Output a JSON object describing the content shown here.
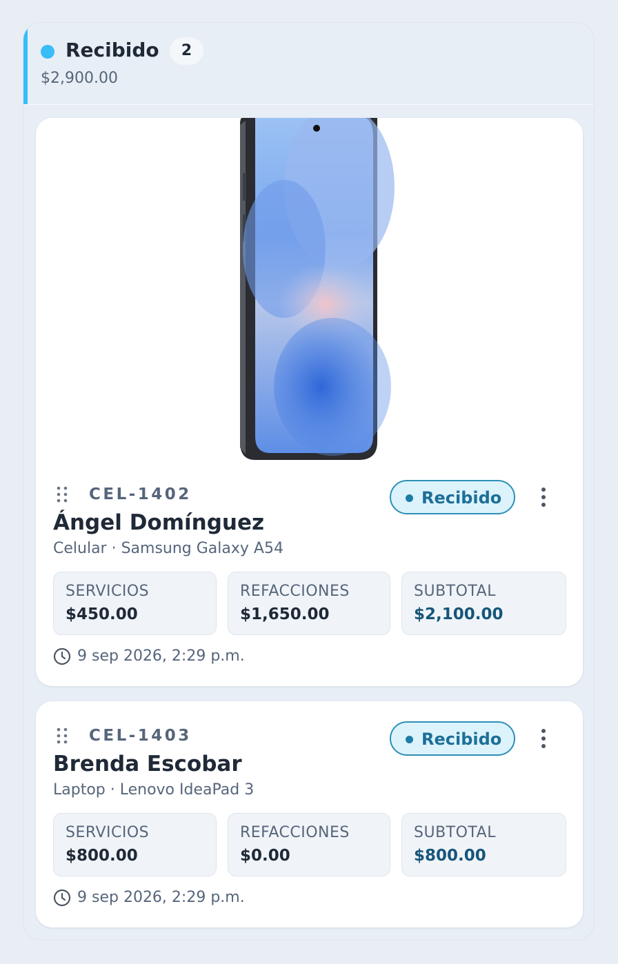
{
  "column": {
    "title": "Recibido",
    "count": "2",
    "total": "$2,900.00",
    "accent_color": "#38bdf8"
  },
  "icons": {
    "drag": "drag-handle-icon",
    "more": "more-vertical-icon",
    "clock": "clock-icon",
    "status": "status-dot-icon"
  },
  "cards": [
    {
      "code": "CEL-1402",
      "status": "Recibido",
      "customer": "Ángel Domínguez",
      "device": "Celular · Samsung Galaxy A54",
      "has_image": true,
      "stats": [
        {
          "label": "SERVICIOS",
          "value": "$450.00"
        },
        {
          "label": "REFACCIONES",
          "value": "$1,650.00"
        },
        {
          "label": "SUBTOTAL",
          "value": "$2,100.00"
        }
      ],
      "date": "9 sep 2026, 2:29 p.m."
    },
    {
      "code": "CEL-1403",
      "status": "Recibido",
      "customer": "Brenda Escobar",
      "device": "Laptop · Lenovo IdeaPad 3",
      "has_image": false,
      "stats": [
        {
          "label": "SERVICIOS",
          "value": "$800.00"
        },
        {
          "label": "REFACCIONES",
          "value": "$0.00"
        },
        {
          "label": "SUBTOTAL",
          "value": "$800.00"
        }
      ],
      "date": "9 sep 2026, 2:29 p.m."
    }
  ]
}
